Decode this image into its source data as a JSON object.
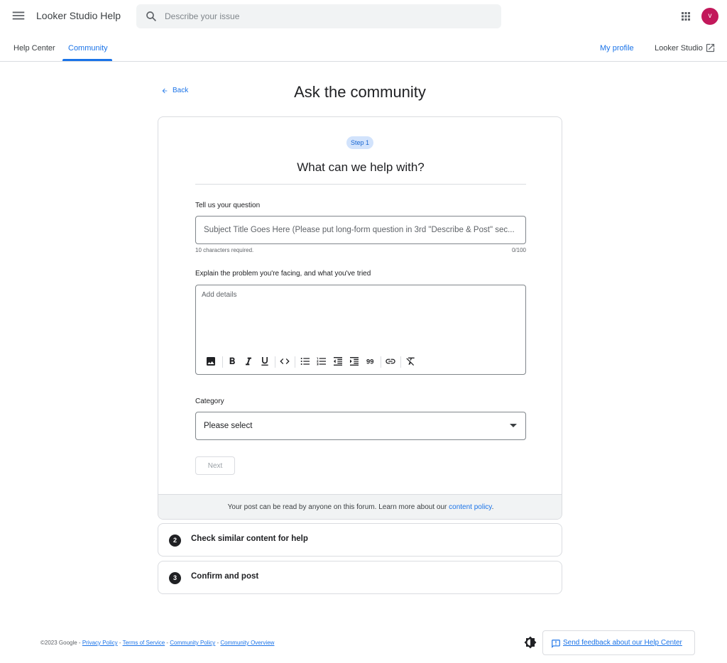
{
  "header": {
    "app_title": "Looker Studio Help",
    "search_placeholder": "Describe your issue",
    "avatar_initial": "v"
  },
  "nav": {
    "tabs": [
      {
        "label": "Help Center",
        "active": false
      },
      {
        "label": "Community",
        "active": true
      }
    ],
    "my_profile": "My profile",
    "looker_studio": "Looker Studio"
  },
  "page": {
    "back_label": "Back",
    "title": "Ask the community"
  },
  "step1": {
    "badge": "Step 1",
    "heading": "What can we help with?",
    "question_label": "Tell us your question",
    "question_placeholder": "Subject Title Goes Here (Please put long-form question in 3rd \"Describe & Post\" sec...",
    "question_helper": "10 characters required.",
    "question_counter": "0/100",
    "details_label": "Explain the problem you're facing, and what you've tried",
    "details_placeholder": "Add details",
    "toolbar": [
      "image-icon",
      "bold-icon",
      "italic-icon",
      "underline-icon",
      "code-icon",
      "bulleted-list-icon",
      "numbered-list-icon",
      "outdent-icon",
      "indent-icon",
      "quote-icon",
      "link-icon",
      "clear-format-icon"
    ],
    "category_label": "Category",
    "category_value": "Please select",
    "next_label": "Next",
    "footer_text": "Your post can be read by anyone on this forum. Learn more about our ",
    "footer_link": "content policy",
    "footer_end": "."
  },
  "steps": [
    {
      "number": "2",
      "title": "Check similar content for help"
    },
    {
      "number": "3",
      "title": "Confirm and post"
    }
  ],
  "footer": {
    "copyright": "©2023 Google - ",
    "links": [
      "Privacy Policy",
      "Terms of Service",
      "Community Policy",
      "Community Overview"
    ],
    "separator": " - ",
    "feedback_label": "Send feedback about our Help Center"
  },
  "colors": {
    "accent": "#1a73e8",
    "avatar": "#c2185b",
    "step_badge_bg": "#d2e3fc"
  }
}
